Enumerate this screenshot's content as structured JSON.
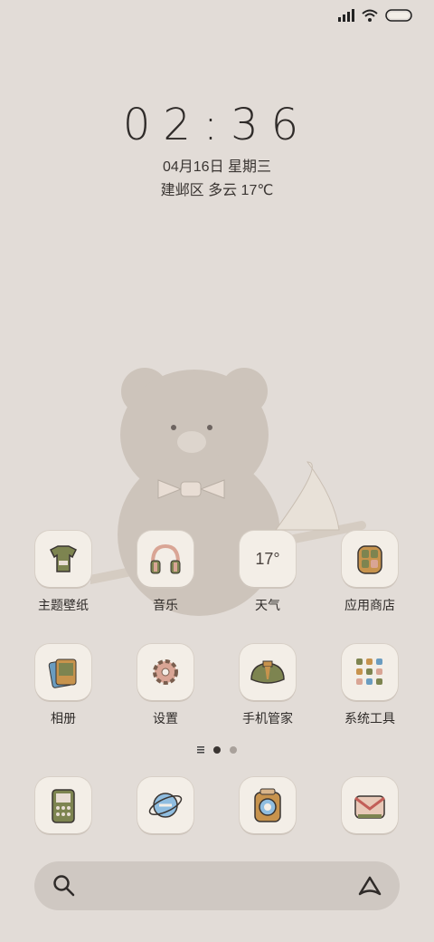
{
  "status_bar": {
    "signal_icon": "signal-icon",
    "wifi_icon": "wifi-icon",
    "battery_icon": "battery-icon"
  },
  "lockscreen": {
    "time": "02:36",
    "date": "04月16日 星期三",
    "weather": "建邺区 多云 17℃"
  },
  "apps_row1": [
    {
      "label": "主题壁纸",
      "icon": "shirt-icon"
    },
    {
      "label": "音乐",
      "icon": "headphones-icon"
    },
    {
      "label": "天气",
      "icon": "weather-icon",
      "text": "17°"
    },
    {
      "label": "应用商店",
      "icon": "backpack-icon"
    }
  ],
  "apps_row2": [
    {
      "label": "相册",
      "icon": "photo-album-icon"
    },
    {
      "label": "设置",
      "icon": "gear-icon"
    },
    {
      "label": "手机管家",
      "icon": "shield-bag-icon"
    },
    {
      "label": "系统工具",
      "icon": "tools-folder-icon"
    }
  ],
  "dock": [
    {
      "icon": "phone-icon"
    },
    {
      "icon": "browser-icon"
    },
    {
      "icon": "camera-icon"
    },
    {
      "icon": "mail-bag-icon"
    }
  ],
  "page_indicator": {
    "pages": 2,
    "current": 1
  },
  "search_bar": {
    "search_icon": "search-icon",
    "assistant_icon": "assistant-icon"
  },
  "colors": {
    "background": "#e2dcd7",
    "tile": "#f3eee7",
    "accent_green": "#7d8450",
    "accent_pink": "#d9a595"
  }
}
